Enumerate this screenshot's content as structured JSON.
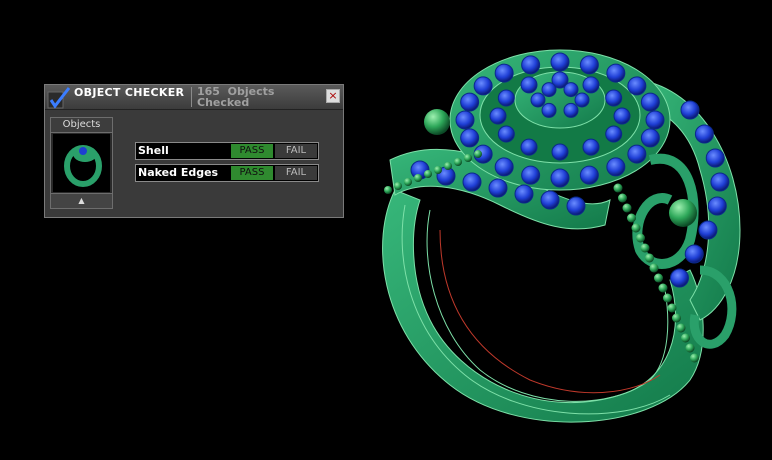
{
  "panel": {
    "title": "OBJECT CHECKER",
    "object_count": "165  Objects Checked",
    "close_label": "×",
    "objects_label": "Objects",
    "scroll_arrow": "▲",
    "checks": [
      {
        "label": "Shell",
        "pass_label": "PASS",
        "fail_label": "FAIL",
        "status": "pass"
      },
      {
        "label": "Naked Edges",
        "pass_label": "PASS",
        "fail_label": "FAIL",
        "status": "pass"
      }
    ]
  },
  "colors": {
    "background": "#000000",
    "ring_metal": "#2aa06a",
    "gem": "#1e3fd0",
    "pass_green": "#2f8a2f"
  }
}
